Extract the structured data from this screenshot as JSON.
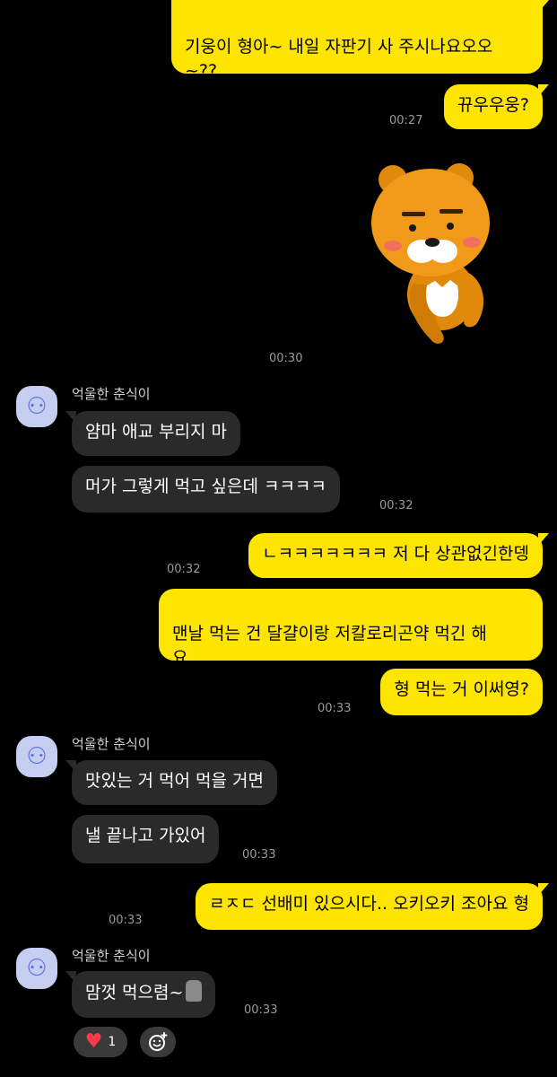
{
  "messages": {
    "m1": {
      "text": "기웅이 형아~ 내일 자판기 사 주시나요오오\n~??"
    },
    "m2": {
      "text": "뀨우우웅?",
      "time": "00:27"
    },
    "sticker": {
      "name": "ryan-sticker",
      "time": "00:30"
    },
    "g1": {
      "sender": "억울한 춘식이",
      "msgs": [
        "얌마 애교 부리지 마",
        "머가 그렇게 먹고 싶은데 ㅋㅋㅋㅋ"
      ],
      "time": "00:32"
    },
    "m3": {
      "text": "ㄴㅋㅋㅋㅋㅋㅋㅋ 저 다 상관없긴한뎅",
      "time": "00:32"
    },
    "m4": {
      "text": "맨날 먹는 건 달걀이랑 저칼로리곤약 먹긴 해\n요"
    },
    "m5": {
      "text": "형 먹는 거 이써영?",
      "time": "00:33"
    },
    "g2": {
      "sender": "억울한 춘식이",
      "msgs": [
        "맛있는 거 먹어 먹을 거면",
        "낼 끝나고 가있어"
      ],
      "time": "00:33"
    },
    "m6": {
      "text": "ㄹㅈㄷ 선배미 있으시다.. 오키오키 조아요 형",
      "time": "00:33"
    },
    "g3": {
      "sender": "억울한 춘식이",
      "msg": "맘껏 먹으렴~",
      "emoji": "moai-emoji",
      "time": "00:33"
    }
  },
  "reactions": {
    "heart_count": "1",
    "heart_icon": "heart-icon",
    "add_icon": "add-reaction-icon"
  },
  "colors": {
    "me_bubble": "#FEE500",
    "them_bubble": "#2a2a2a",
    "background": "#000000"
  }
}
